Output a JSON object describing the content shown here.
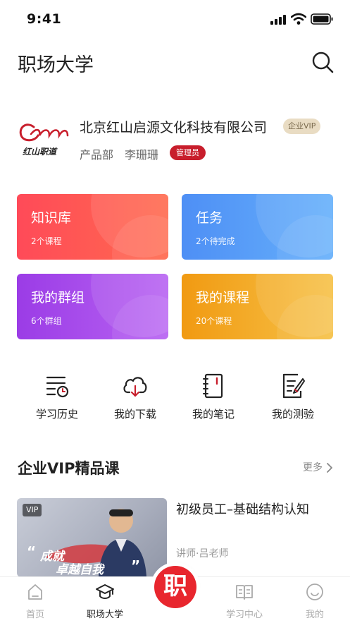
{
  "status_bar": {
    "time": "9:41"
  },
  "header": {
    "title": "职场大学",
    "search_icon": "search-icon"
  },
  "company": {
    "logo_text": "红山职道",
    "name": "北京红山启源文化科技有限公司",
    "vip_badge": "企业VIP",
    "department": "产品部",
    "user_name": "李珊珊",
    "role": "管理员"
  },
  "quick_cards": [
    {
      "title": "知识库",
      "subtitle": "2个课程",
      "color": "#ff4a58"
    },
    {
      "title": "任务",
      "subtitle": "2个待完成",
      "color": "#4e8ff5"
    },
    {
      "title": "我的群组",
      "subtitle": "6个群组",
      "color": "#9b3ce6"
    },
    {
      "title": "我的课程",
      "subtitle": "20个课程",
      "color": "#f19a12"
    }
  ],
  "shortcuts": [
    {
      "label": "学习历史",
      "icon": "history-icon"
    },
    {
      "label": "我的下载",
      "icon": "cloud-download-icon"
    },
    {
      "label": "我的笔记",
      "icon": "notebook-icon"
    },
    {
      "label": "我的测验",
      "icon": "quiz-icon"
    }
  ],
  "vip_section": {
    "title": "企业VIP精品课",
    "more": "更多",
    "course": {
      "badge": "VIP",
      "slogan_line1": "成就",
      "slogan_line2": "卓越自我",
      "title": "初级员工–基础结构认知",
      "teacher": "讲师·吕老师"
    }
  },
  "tab_bar": {
    "tabs": [
      {
        "label": "首页",
        "icon": "home-icon",
        "active": false
      },
      {
        "label": "职场大学",
        "icon": "graduation-cap-icon",
        "active": true
      },
      {
        "label": "学习中心",
        "icon": "book-icon",
        "active": false
      },
      {
        "label": "我的",
        "icon": "smile-icon",
        "active": false
      }
    ],
    "center_char": "职"
  },
  "colors": {
    "accent_red": "#e8262e",
    "role_badge": "#c81e2c",
    "vip_badge_bg": "#e9dcc3"
  }
}
